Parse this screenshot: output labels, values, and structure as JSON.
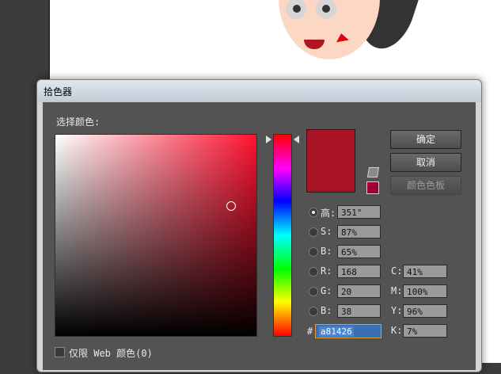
{
  "dialog": {
    "title": "拾色器",
    "select_color_label": "选择颜色:",
    "buttons": {
      "ok": "确定",
      "cancel": "取消",
      "swatches": "颜色色板"
    },
    "hsb": {
      "h_label": "高:",
      "h_value": "351°",
      "s_label": "S:",
      "s_value": "87%",
      "b_label": "B:",
      "b_value": "65%"
    },
    "rgb": {
      "r_label": "R:",
      "r_value": "168",
      "g_label": "G:",
      "g_value": "20",
      "b_label": "B:",
      "b_value": "38"
    },
    "cmyk": {
      "c_label": "C:",
      "c_value": "41%",
      "m_label": "M:",
      "m_value": "100%",
      "y_label": "Y:",
      "y_value": "96%",
      "k_label": "K:",
      "k_value": "7%"
    },
    "hex_label": "#",
    "hex_value": "a81426",
    "web_only_label": "仅限 Web 颜色(0)",
    "selected_color": "#a81426"
  }
}
